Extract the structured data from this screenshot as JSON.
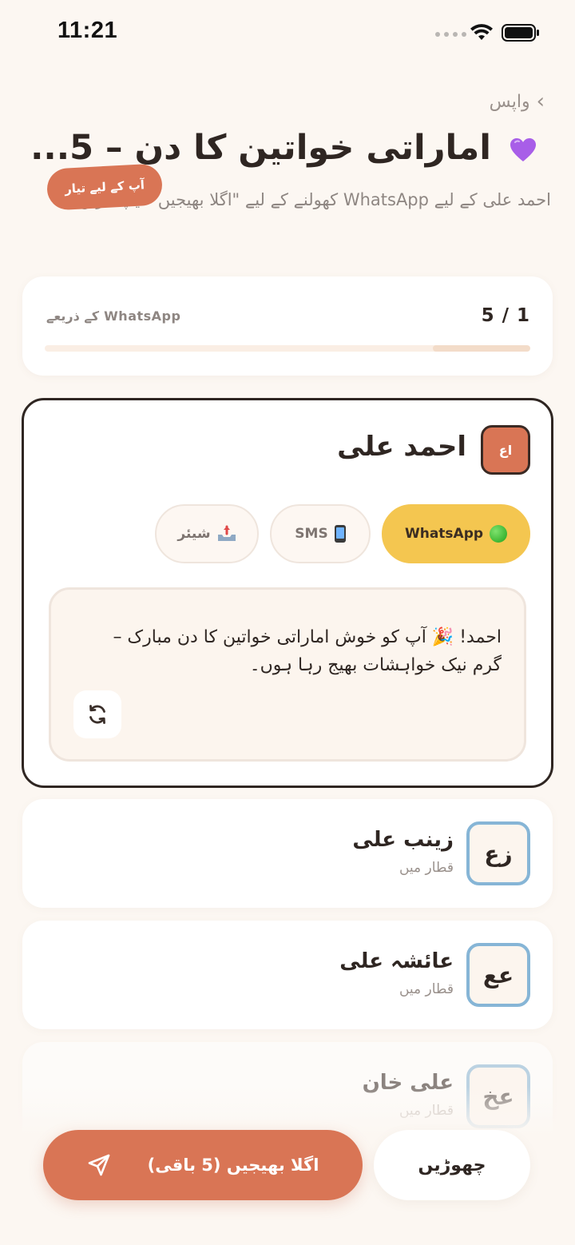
{
  "status_bar": {
    "time": "11:21"
  },
  "header": {
    "back_label": "واپس",
    "title": "اماراتی خواتین کا دن – 5...",
    "title_emoji": "purple-heart",
    "subtitle": "احمد علی کے لیے WhatsApp کھولنے کے لیے \"اگلا بھیجیں\" ٹیپ کریں۔"
  },
  "progress": {
    "count": "5 / 1",
    "channel_label": "WhatsApp کے ذریعے",
    "fraction": 0.2
  },
  "active_contact": {
    "initials": "اع",
    "name": "احمد علی",
    "channels": [
      {
        "label": "WhatsApp",
        "icon": "green-circle-icon",
        "selected": true
      },
      {
        "label": "SMS",
        "icon": "mobile-phone-icon",
        "selected": false
      },
      {
        "label": "شیئر",
        "icon": "outbox-tray-icon",
        "selected": false
      }
    ],
    "ready_badge": "آپ کے لیے تیار",
    "message": "احمد! 🎉 آپ کو خوش اماراتی خواتین کا دن مبارک – گرم نیک خواہشات بھیج رہا ہوں۔"
  },
  "queue": [
    {
      "initials": "زع",
      "name": "زینب علی",
      "status": "قطار میں"
    },
    {
      "initials": "عع",
      "name": "عائشہ علی",
      "status": "قطار میں"
    },
    {
      "initials": "عخ",
      "name": "علی خان",
      "status": "قطار میں"
    }
  ],
  "actions": {
    "send_label": "اگلا بھیجیں (5 باقی)",
    "skip_label": "چھوڑیں"
  },
  "colors": {
    "background": "#fcf7f2",
    "accent": "#d97555",
    "whatsapp_selected": "#f4c650",
    "queue_avatar_border": "#86b5d6",
    "text_primary": "#2f2622"
  }
}
